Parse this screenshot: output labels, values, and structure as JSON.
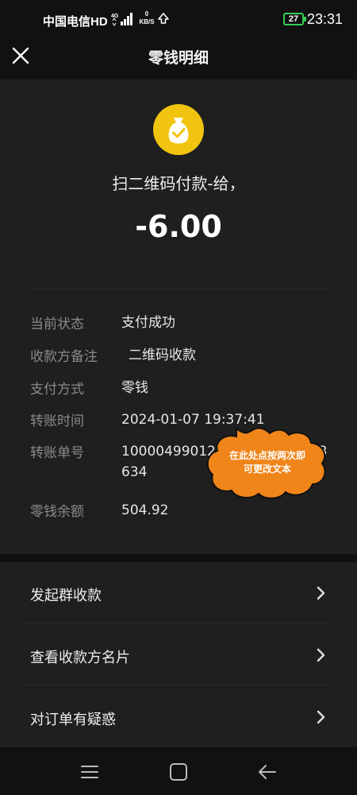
{
  "status_bar": {
    "carrier": "中国电信HD",
    "network": "4G",
    "net_speed_value": "0",
    "net_speed_unit": "KB/S",
    "battery": "27",
    "time": "23:31"
  },
  "header": {
    "title": "零钱明细",
    "close_icon": "close-icon"
  },
  "transaction": {
    "icon": "money-bag-check-icon",
    "payee": "扫二维码付款-给，",
    "amount": "-6.00"
  },
  "details": [
    {
      "label": "当前状态",
      "value": "支付成功"
    },
    {
      "label": "收款方备注",
      "value": "二维码收款"
    },
    {
      "label": "支付方式",
      "value": "零钱"
    },
    {
      "label": "转账时间",
      "value": "2024-01-07 19:37:41"
    },
    {
      "label": "转账单号",
      "value": "100004990124010700063553634"
    },
    {
      "label": "零钱余额",
      "value": "504.92"
    }
  ],
  "tooltip": {
    "line1": "在此处点按两次即",
    "line2": "可更改文本"
  },
  "actions": [
    {
      "label": "发起群收款"
    },
    {
      "label": "查看收款方名片"
    },
    {
      "label": "对订单有疑惑"
    }
  ],
  "colors": {
    "background": "#111111",
    "card": "#1f1f1f",
    "coin": "#f1c40f",
    "bubble": "#f0851a",
    "battery": "#33cc55"
  }
}
